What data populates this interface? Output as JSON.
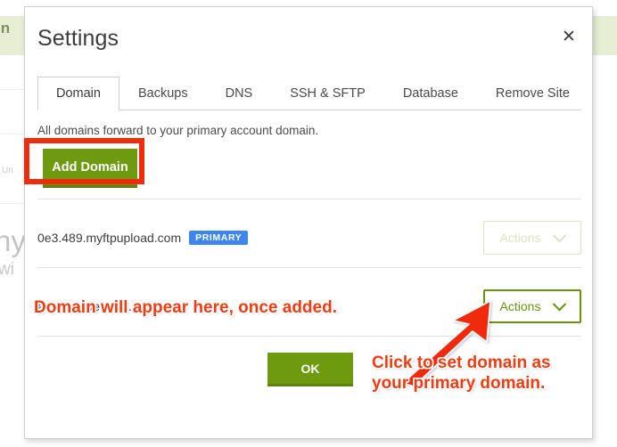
{
  "background": {
    "login_label": "In",
    "un_label": "Un",
    "ny_label": "ny",
    "wi_label": "wi",
    "band_color": "#dfe8c4"
  },
  "modal": {
    "title": "Settings",
    "close_icon": "✕",
    "tabs": [
      {
        "label": "Domain",
        "active": true
      },
      {
        "label": "Backups",
        "active": false
      },
      {
        "label": "DNS",
        "active": false
      },
      {
        "label": "SSH & SFTP",
        "active": false
      },
      {
        "label": "Database",
        "active": false
      },
      {
        "label": "Remove Site",
        "active": false
      }
    ],
    "subtitle": "All domains forward to your primary account domain.",
    "add_domain_label": "Add Domain",
    "ok_label": "OK",
    "rows": [
      {
        "domain": "0e3.489.myftpupload.com",
        "badge": "PRIMARY",
        "actions_label": "Actions",
        "actions_state": "faded"
      },
      {
        "domain": "analternateroute.com",
        "badge": "",
        "actions_label": "Actions",
        "actions_state": "strong"
      }
    ]
  },
  "annotations": {
    "domain_note": "Domain will appear here, once added.",
    "primary_note": "Click to set domain as\nyour primary domain.",
    "color": "#f03c13",
    "box_color": "#f02b0b"
  }
}
